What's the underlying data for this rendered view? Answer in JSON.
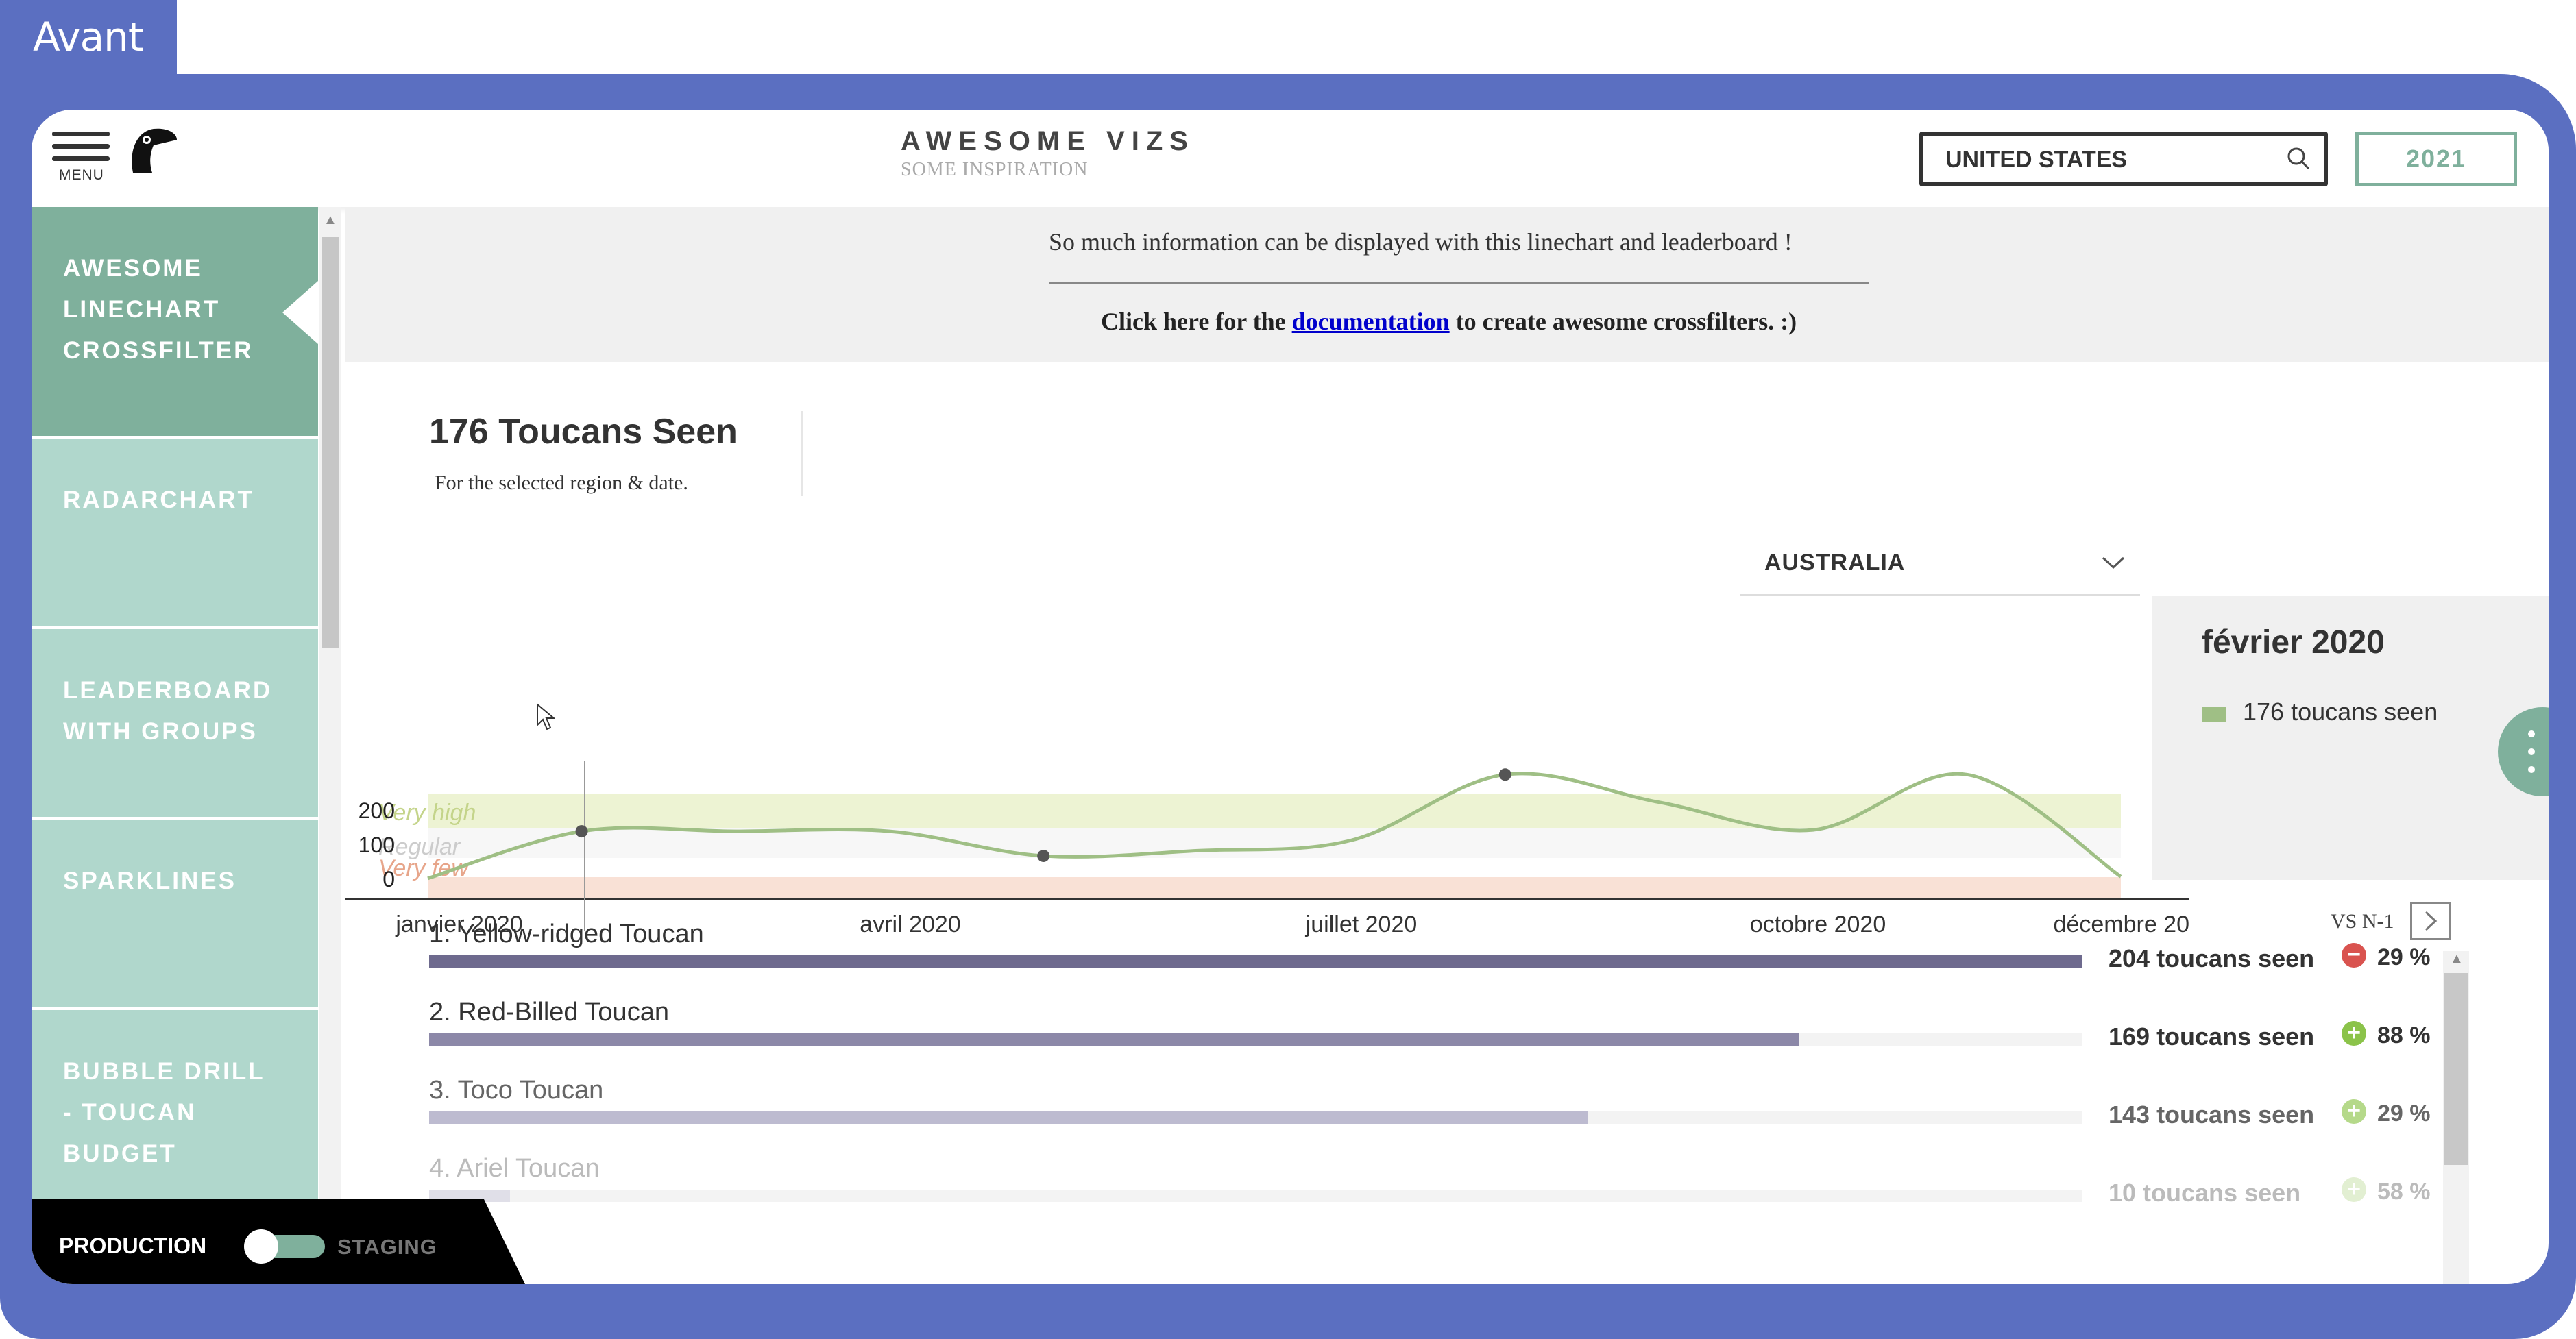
{
  "window": {
    "tab_label": "Avant"
  },
  "header": {
    "menu_label": "MENU",
    "title": "AWESOME VIZS",
    "subtitle": "SOME INSPIRATION",
    "search": {
      "value": "UNITED STATES",
      "icon": "search-icon"
    },
    "year": "2021"
  },
  "sidebar": {
    "items": [
      {
        "label": "AWESOME LINECHART CROSSFILTER",
        "active": true
      },
      {
        "label": "RADARCHART"
      },
      {
        "label": "LEADERBOARD WITH GROUPS"
      },
      {
        "label": "SPARKLINES"
      },
      {
        "label": "BUBBLE DRILL - TOUCAN BUDGET"
      }
    ]
  },
  "env_toggle": {
    "left_label": "PRODUCTION",
    "right_label": "STAGING",
    "selected": "PRODUCTION"
  },
  "info": {
    "line1": "So much information can be displayed with this linechart and leaderboard !",
    "line2_prefix": "Click here for the ",
    "link_text": "documentation",
    "line2_suffix": " to create awesome crossfilters. :)"
  },
  "kpi": {
    "title": "176 Toucans Seen",
    "subtitle": "For the selected region & date."
  },
  "region_select": {
    "value": "AUSTRALIA"
  },
  "tooltip": {
    "date": "février 2020",
    "value": "176 toucans seen"
  },
  "chart_data": {
    "type": "line",
    "x_tick_labels": [
      "janvier 2020",
      "avril 2020",
      "juillet 2020",
      "octobre 2020",
      "décembre 20"
    ],
    "y_tick_labels": [
      "200",
      "100",
      "0"
    ],
    "bands": [
      {
        "label": "Very high",
        "color": "#e8f0c8"
      },
      {
        "label": "Regular",
        "color": "#f5f5f5"
      },
      {
        "label": "Very few",
        "color": "#f7d9cc"
      }
    ],
    "series": [
      {
        "color": "#9fbf85",
        "x": [
          "janvier 2020",
          "février 2020",
          "mars 2020",
          "avril 2020",
          "mai 2020",
          "juin 2020",
          "juillet 2020",
          "août 2020",
          "septembre 2020",
          "octobre 2020",
          "novembre 2020",
          "décembre 2020"
        ],
        "values": [
          40,
          176,
          176,
          176,
          105,
          120,
          150,
          340,
          260,
          180,
          340,
          45
        ]
      }
    ],
    "highlight_points": [
      "février 2020",
      "mai 2020",
      "août 2020"
    ],
    "ylim": [
      0,
      400
    ]
  },
  "leaderboard": {
    "compare_label": "VS N-1",
    "rows": [
      {
        "rank_name": "1. Yellow-ridged Toucan",
        "value_label": "204 toucans seen",
        "value": 204,
        "trend": "down",
        "pct": "29 %",
        "bar_color": "#6e6a8e",
        "text_color": "#333333",
        "badge_color": "#d9534f"
      },
      {
        "rank_name": "2. Red-Billed Toucan",
        "value_label": "169 toucans seen",
        "value": 169,
        "trend": "up",
        "pct": "88 %",
        "bar_color": "#8c88a8",
        "text_color": "#333333",
        "badge_color": "#8bc34a"
      },
      {
        "rank_name": "3. Toco Toucan",
        "value_label": "143 toucans seen",
        "value": 143,
        "trend": "up",
        "pct": "29 %",
        "bar_color": "#bdbbd0",
        "text_color": "#666666",
        "badge_color": "#b5d98a"
      },
      {
        "rank_name": "4. Ariel Toucan",
        "value_label": "10 toucans seen",
        "value": 10,
        "trend": "up",
        "pct": "58 %",
        "bar_color": "#e0dfe8",
        "text_color": "#bbbbbb",
        "badge_color": "#e2efd2"
      }
    ],
    "max_value": 204
  },
  "colors": {
    "frame": "#5b6fc1",
    "accent": "#7fb09c",
    "sidebar": "#b0d7cc"
  }
}
